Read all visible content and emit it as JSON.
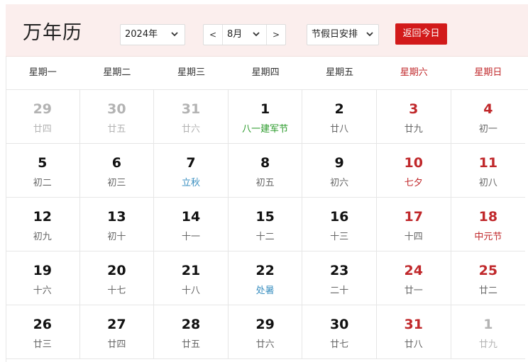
{
  "header": {
    "title": "万年历",
    "year_select": "2024年",
    "month_prev": "<",
    "month_value": "8月",
    "month_next": ">",
    "holiday_select": "节假日安排",
    "today_button": "返回今日"
  },
  "colors": {
    "header_bg": "#fbeeed",
    "accent_red": "#d21a1a",
    "weekend_red": "#c0282b",
    "holiday_green": "#2a9a2a",
    "solar_term_blue": "#3a8fc0",
    "muted_gray": "#b3b3b3"
  },
  "weekdays": [
    "星期一",
    "星期二",
    "星期三",
    "星期四",
    "星期五",
    "星期六",
    "星期日"
  ],
  "weeks": [
    [
      {
        "solar": "29",
        "lunar": "廿四",
        "other_month": true
      },
      {
        "solar": "30",
        "lunar": "廿五",
        "other_month": true
      },
      {
        "solar": "31",
        "lunar": "廿六",
        "other_month": true
      },
      {
        "solar": "1",
        "lunar": "八一建军节",
        "festival": "holiday"
      },
      {
        "solar": "2",
        "lunar": "廿八"
      },
      {
        "solar": "3",
        "lunar": "廿九"
      },
      {
        "solar": "4",
        "lunar": "初一"
      }
    ],
    [
      {
        "solar": "5",
        "lunar": "初二"
      },
      {
        "solar": "6",
        "lunar": "初三"
      },
      {
        "solar": "7",
        "lunar": "立秋",
        "festival": "term"
      },
      {
        "solar": "8",
        "lunar": "初五"
      },
      {
        "solar": "9",
        "lunar": "初六"
      },
      {
        "solar": "10",
        "lunar": "七夕",
        "festival": "red"
      },
      {
        "solar": "11",
        "lunar": "初八"
      }
    ],
    [
      {
        "solar": "12",
        "lunar": "初九"
      },
      {
        "solar": "13",
        "lunar": "初十"
      },
      {
        "solar": "14",
        "lunar": "十一"
      },
      {
        "solar": "15",
        "lunar": "十二"
      },
      {
        "solar": "16",
        "lunar": "十三"
      },
      {
        "solar": "17",
        "lunar": "十四"
      },
      {
        "solar": "18",
        "lunar": "中元节",
        "festival": "red"
      }
    ],
    [
      {
        "solar": "19",
        "lunar": "十六"
      },
      {
        "solar": "20",
        "lunar": "十七"
      },
      {
        "solar": "21",
        "lunar": "十八"
      },
      {
        "solar": "22",
        "lunar": "处暑",
        "festival": "term"
      },
      {
        "solar": "23",
        "lunar": "二十"
      },
      {
        "solar": "24",
        "lunar": "廿一"
      },
      {
        "solar": "25",
        "lunar": "廿二"
      }
    ],
    [
      {
        "solar": "26",
        "lunar": "廿三"
      },
      {
        "solar": "27",
        "lunar": "廿四"
      },
      {
        "solar": "28",
        "lunar": "廿五"
      },
      {
        "solar": "29",
        "lunar": "廿六"
      },
      {
        "solar": "30",
        "lunar": "廿七"
      },
      {
        "solar": "31",
        "lunar": "廿八"
      },
      {
        "solar": "1",
        "lunar": "廿九",
        "other_month": true
      }
    ]
  ]
}
